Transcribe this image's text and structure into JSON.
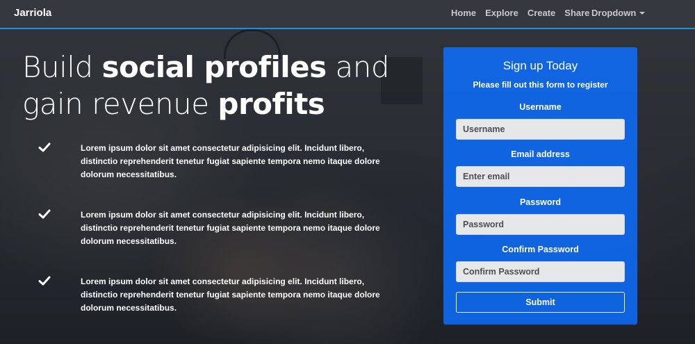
{
  "navbar": {
    "brand": "Jarriola",
    "links": [
      "Home",
      "Explore",
      "Create",
      "Share"
    ],
    "dropdown_label": "Dropdown"
  },
  "hero": {
    "line1_light": "Build ",
    "line1_bold": "social profiles",
    "line1_tail": " and",
    "line2_light": "gain revenue ",
    "line2_bold": "profits"
  },
  "features": [
    {
      "icon": "check-icon",
      "text": "Lorem ipsum dolor sit amet consectetur adipisicing elit. Incidunt libero, distinctio reprehenderit tenetur fugiat sapiente tempora nemo itaque dolore dolorum necessitatibus."
    },
    {
      "icon": "check-icon",
      "text": "Lorem ipsum dolor sit amet consectetur adipisicing elit. Incidunt libero, distinctio reprehenderit tenetur fugiat sapiente tempora nemo itaque dolore dolorum necessitatibus."
    },
    {
      "icon": "check-icon",
      "text": "Lorem ipsum dolor sit amet consectetur adipisicing elit. Incidunt libero, distinctio reprehenderit tenetur fugiat sapiente tempora nemo itaque dolore dolorum necessitatibus."
    }
  ],
  "signup": {
    "title": "Sign up Today",
    "subtitle": "Please fill out this form to register",
    "fields": [
      {
        "label": "Username",
        "placeholder": "Username",
        "value": ""
      },
      {
        "label": "Email address",
        "placeholder": "Enter email",
        "value": ""
      },
      {
        "label": "Password",
        "placeholder": "Password",
        "value": ""
      },
      {
        "label": "Confirm Password",
        "placeholder": "Confirm Password",
        "value": ""
      }
    ],
    "submit_label": "Submit"
  },
  "colors": {
    "navbar_accent": "#1f8de0",
    "card_background": "#0d6efd"
  }
}
